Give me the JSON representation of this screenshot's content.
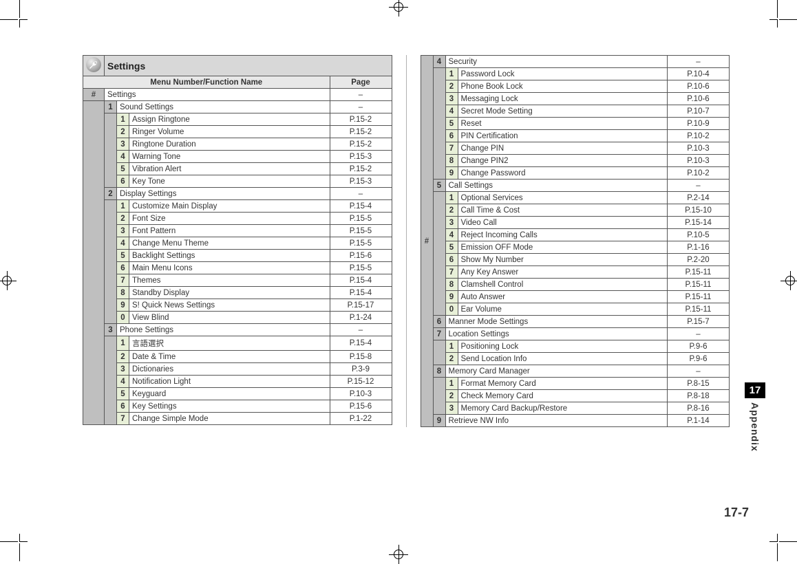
{
  "title": "Settings",
  "header_menu": "Menu Number/Function Name",
  "header_page": "Page",
  "hash": "#",
  "dash": "–",
  "side_tab": {
    "num": "17",
    "label": "Appendix"
  },
  "page_number": "17-7",
  "left": {
    "root": {
      "name": "Settings"
    },
    "groups": [
      {
        "num": "1",
        "name": "Sound Settings",
        "page": "–",
        "items": [
          {
            "num": "1",
            "name": "Assign Ringtone",
            "page": "P.15-2"
          },
          {
            "num": "2",
            "name": "Ringer Volume",
            "page": "P.15-2"
          },
          {
            "num": "3",
            "name": "Ringtone Duration",
            "page": "P.15-2"
          },
          {
            "num": "4",
            "name": "Warning Tone",
            "page": "P.15-3"
          },
          {
            "num": "5",
            "name": "Vibration Alert",
            "page": "P.15-2"
          },
          {
            "num": "6",
            "name": "Key Tone",
            "page": "P.15-3"
          }
        ]
      },
      {
        "num": "2",
        "name": "Display Settings",
        "page": "–",
        "items": [
          {
            "num": "1",
            "name": "Customize Main Display",
            "page": "P.15-4"
          },
          {
            "num": "2",
            "name": "Font Size",
            "page": "P.15-5"
          },
          {
            "num": "3",
            "name": "Font Pattern",
            "page": "P.15-5"
          },
          {
            "num": "4",
            "name": "Change Menu Theme",
            "page": "P.15-5"
          },
          {
            "num": "5",
            "name": "Backlight Settings",
            "page": "P.15-6"
          },
          {
            "num": "6",
            "name": "Main Menu Icons",
            "page": "P.15-5"
          },
          {
            "num": "7",
            "name": "Themes",
            "page": "P.15-4"
          },
          {
            "num": "8",
            "name": "Standby Display",
            "page": "P.15-4"
          },
          {
            "num": "9",
            "name": "S! Quick News Settings",
            "page": "P.15-17"
          },
          {
            "num": "0",
            "name": "View Blind",
            "page": "P.1-24"
          }
        ]
      },
      {
        "num": "3",
        "name": "Phone Settings",
        "page": "–",
        "items": [
          {
            "num": "1",
            "name": "言語選択",
            "page": "P.15-4"
          },
          {
            "num": "2",
            "name": "Date & Time",
            "page": "P.15-8"
          },
          {
            "num": "3",
            "name": "Dictionaries",
            "page": "P.3-9"
          },
          {
            "num": "4",
            "name": "Notification Light",
            "page": "P.15-12"
          },
          {
            "num": "5",
            "name": "Keyguard",
            "page": "P.10-3"
          },
          {
            "num": "6",
            "name": "Key Settings",
            "page": "P.15-6"
          },
          {
            "num": "7",
            "name": "Change Simple Mode",
            "page": "P.1-22"
          }
        ]
      }
    ]
  },
  "right": {
    "groups": [
      {
        "num": "4",
        "name": "Security",
        "page": "–",
        "items": [
          {
            "num": "1",
            "name": "Password Lock",
            "page": "P.10-4"
          },
          {
            "num": "2",
            "name": "Phone Book Lock",
            "page": "P.10-6"
          },
          {
            "num": "3",
            "name": "Messaging Lock",
            "page": "P.10-6"
          },
          {
            "num": "4",
            "name": "Secret Mode Setting",
            "page": "P.10-7"
          },
          {
            "num": "5",
            "name": "Reset",
            "page": "P.10-9"
          },
          {
            "num": "6",
            "name": "PIN Certification",
            "page": "P.10-2"
          },
          {
            "num": "7",
            "name": "Change PIN",
            "page": "P.10-3"
          },
          {
            "num": "8",
            "name": "Change PIN2",
            "page": "P.10-3"
          },
          {
            "num": "9",
            "name": "Change Password",
            "page": "P.10-2"
          }
        ]
      },
      {
        "num": "5",
        "name": "Call Settings",
        "page": "–",
        "items": [
          {
            "num": "1",
            "name": "Optional Services",
            "page": "P.2-14"
          },
          {
            "num": "2",
            "name": "Call Time & Cost",
            "page": "P.15-10"
          },
          {
            "num": "3",
            "name": "Video Call",
            "page": "P.15-14"
          },
          {
            "num": "4",
            "name": "Reject Incoming Calls",
            "page": "P.10-5"
          },
          {
            "num": "5",
            "name": "Emission OFF Mode",
            "page": "P.1-16"
          },
          {
            "num": "6",
            "name": "Show My Number",
            "page": "P.2-20"
          },
          {
            "num": "7",
            "name": "Any Key Answer",
            "page": "P.15-11"
          },
          {
            "num": "8",
            "name": "Clamshell Control",
            "page": "P.15-11"
          },
          {
            "num": "9",
            "name": "Auto Answer",
            "page": "P.15-11"
          },
          {
            "num": "0",
            "name": "Ear Volume",
            "page": "P.15-11"
          }
        ]
      },
      {
        "num": "6",
        "name": "Manner Mode Settings",
        "page": "P.15-7",
        "items": []
      },
      {
        "num": "7",
        "name": "Location Settings",
        "page": "–",
        "items": [
          {
            "num": "1",
            "name": "Positioning Lock",
            "page": "P.9-6"
          },
          {
            "num": "2",
            "name": "Send Location Info",
            "page": "P.9-6"
          }
        ]
      },
      {
        "num": "8",
        "name": "Memory Card Manager",
        "page": "–",
        "items": [
          {
            "num": "1",
            "name": "Format Memory Card",
            "page": "P.8-15"
          },
          {
            "num": "2",
            "name": "Check Memory Card",
            "page": "P.8-18"
          },
          {
            "num": "3",
            "name": "Memory Card Backup/Restore",
            "page": "P.8-16"
          }
        ]
      },
      {
        "num": "9",
        "name": "Retrieve NW Info",
        "page": "P.1-14",
        "items": []
      }
    ]
  }
}
